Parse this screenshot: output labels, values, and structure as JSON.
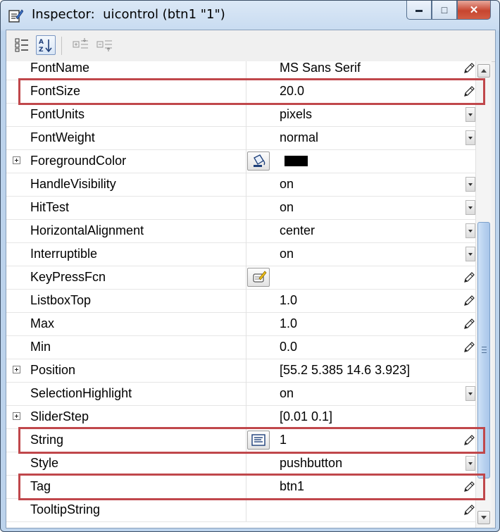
{
  "window": {
    "title": "Inspector:  uicontrol (btn1 \"1\")",
    "controls": {
      "minimize": "▬",
      "maximize": "□",
      "close": "✕"
    }
  },
  "toolbar": {
    "icons": [
      "categorized-view-icon",
      "alphabetical-sort-icon",
      "expand-all-icon",
      "collapse-all-icon"
    ]
  },
  "properties": [
    {
      "name": "FontName",
      "value": "MS Sans Serif",
      "control": "pencil",
      "expand": false
    },
    {
      "name": "FontSize",
      "value": "20.0",
      "control": "pencil",
      "expand": false
    },
    {
      "name": "FontUnits",
      "value": "pixels",
      "control": "dropdown",
      "expand": false
    },
    {
      "name": "FontWeight",
      "value": "normal",
      "control": "dropdown",
      "expand": false
    },
    {
      "name": "ForegroundColor",
      "value": "",
      "control": "color",
      "expand": true
    },
    {
      "name": "HandleVisibility",
      "value": "on",
      "control": "dropdown",
      "expand": false
    },
    {
      "name": "HitTest",
      "value": "on",
      "control": "dropdown",
      "expand": false
    },
    {
      "name": "HorizontalAlignment",
      "value": "center",
      "control": "dropdown",
      "expand": false
    },
    {
      "name": "Interruptible",
      "value": "on",
      "control": "dropdown",
      "expand": false
    },
    {
      "name": "KeyPressFcn",
      "value": "",
      "control": "callback",
      "expand": false
    },
    {
      "name": "ListboxTop",
      "value": "1.0",
      "control": "pencil",
      "expand": false
    },
    {
      "name": "Max",
      "value": "1.0",
      "control": "pencil",
      "expand": false
    },
    {
      "name": "Min",
      "value": "0.0",
      "control": "pencil",
      "expand": false
    },
    {
      "name": "Position",
      "value": "[55.2 5.385 14.6 3.923]",
      "control": "none",
      "expand": true
    },
    {
      "name": "SelectionHighlight",
      "value": "on",
      "control": "dropdown",
      "expand": false
    },
    {
      "name": "SliderStep",
      "value": "[0.01 0.1]",
      "control": "none",
      "expand": true
    },
    {
      "name": "String",
      "value": "1",
      "control": "text-editor",
      "expand": false
    },
    {
      "name": "Style",
      "value": "pushbutton",
      "control": "dropdown",
      "expand": false
    },
    {
      "name": "Tag",
      "value": "btn1",
      "control": "pencil",
      "expand": false
    },
    {
      "name": "TooltipString",
      "value": "",
      "control": "pencil",
      "expand": false
    }
  ],
  "colors": {
    "highlight": "#c0474b",
    "foreground_swatch": "#000000"
  },
  "highlighted": [
    "FontSize",
    "String",
    "Tag"
  ]
}
